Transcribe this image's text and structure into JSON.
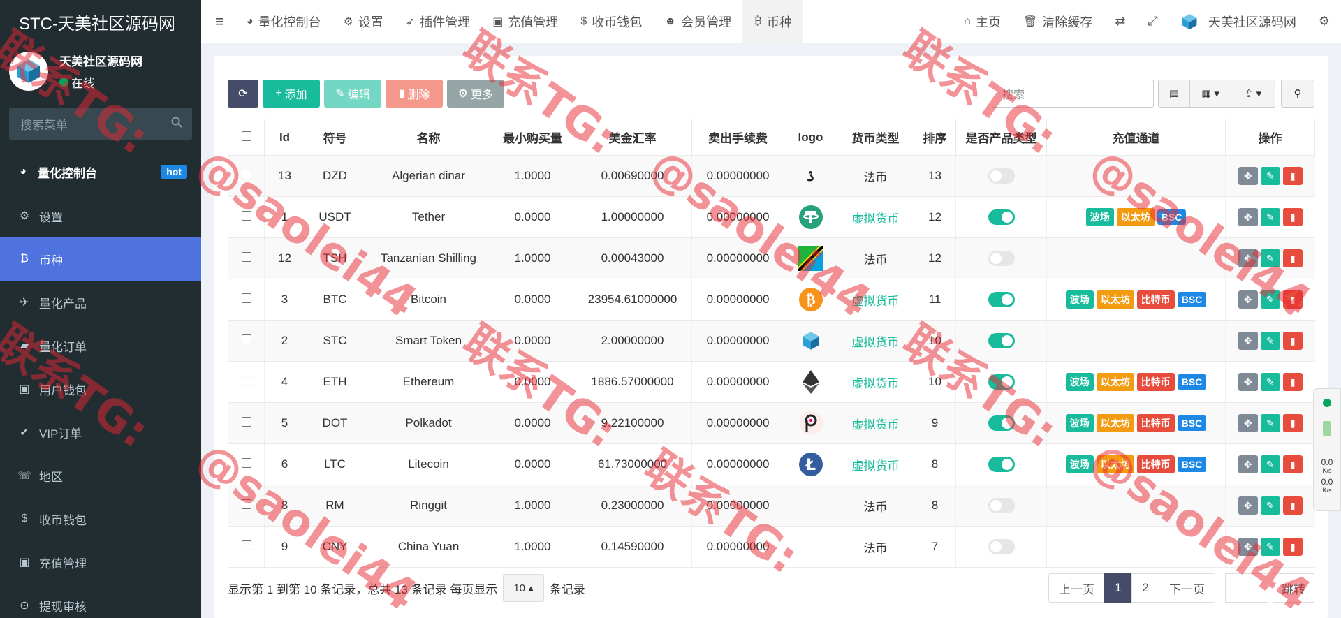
{
  "sidebar": {
    "brand": "STC-天美社区源码网",
    "user_name": "天美社区源码网",
    "user_status": "在线",
    "search_placeholder": "搜索菜单",
    "hot_badge": "hot",
    "items": [
      {
        "label": "量化控制台",
        "icon": "dashboard-icon",
        "glyph": "◕"
      },
      {
        "label": "设置",
        "icon": "gear-icon",
        "glyph": "⚙"
      },
      {
        "label": "币种",
        "icon": "bitcoin-icon",
        "glyph": "₿"
      },
      {
        "label": "量化产品",
        "icon": "plane-icon",
        "glyph": "✈"
      },
      {
        "label": "量化订单",
        "icon": "book-icon",
        "glyph": "▰"
      },
      {
        "label": "用户钱包",
        "icon": "money-icon",
        "glyph": "▣"
      },
      {
        "label": "VIP订单",
        "icon": "check-circle-icon",
        "glyph": "✔"
      },
      {
        "label": "地区",
        "icon": "phone-icon",
        "glyph": "☏"
      },
      {
        "label": "收币钱包",
        "icon": "dollar-icon",
        "glyph": "$"
      },
      {
        "label": "充值管理",
        "icon": "money-icon",
        "glyph": "▣"
      },
      {
        "label": "提现审核",
        "icon": "arrow-up-circle-icon",
        "glyph": "⊙"
      }
    ]
  },
  "topnav": {
    "tabs": [
      {
        "label": "量化控制台",
        "icon": "dashboard-icon",
        "glyph": "◕"
      },
      {
        "label": "设置",
        "icon": "gear-icon",
        "glyph": "⚙"
      },
      {
        "label": "插件管理",
        "icon": "rocket-icon",
        "glyph": "➶"
      },
      {
        "label": "充值管理",
        "icon": "money-icon",
        "glyph": "▣"
      },
      {
        "label": "收币钱包",
        "icon": "dollar-icon",
        "glyph": "$"
      },
      {
        "label": "会员管理",
        "icon": "user-icon",
        "glyph": "☻"
      },
      {
        "label": "币种",
        "icon": "bitcoin-icon",
        "glyph": "₿"
      }
    ],
    "home": "主页",
    "clear_cache": "清除缓存",
    "site_name": "天美社区源码网"
  },
  "toolbar": {
    "add": "添加",
    "edit": "编辑",
    "delete": "删除",
    "more": "更多",
    "search_placeholder": "搜索"
  },
  "table": {
    "headers": [
      "Id",
      "符号",
      "名称",
      "最小购买量",
      "美金汇率",
      "卖出手续费",
      "logo",
      "货币类型",
      "排序",
      "是否产品类型",
      "充值通道",
      "操作"
    ],
    "rows": [
      {
        "id": "13",
        "symbol": "DZD",
        "name": "Algerian dinar",
        "min": "1.0000",
        "rate": "0.00690000",
        "fee": "0.00000000",
        "logo": "dzd",
        "type": "法币",
        "virtual": false,
        "sort": "13",
        "product": false,
        "channels": []
      },
      {
        "id": "1",
        "symbol": "USDT",
        "name": "Tether",
        "min": "0.0000",
        "rate": "1.00000000",
        "fee": "0.00000000",
        "logo": "usdt",
        "type": "虚拟货币",
        "virtual": true,
        "sort": "12",
        "product": true,
        "channels": [
          "波场",
          "以太坊",
          "BSC"
        ]
      },
      {
        "id": "12",
        "symbol": "TSH",
        "name": "Tanzanian Shilling",
        "min": "1.0000",
        "rate": "0.00043000",
        "fee": "0.00000000",
        "logo": "tsh",
        "type": "法币",
        "virtual": false,
        "sort": "12",
        "product": false,
        "channels": []
      },
      {
        "id": "3",
        "symbol": "BTC",
        "name": "Bitcoin",
        "min": "0.0000",
        "rate": "23954.61000000",
        "fee": "0.00000000",
        "logo": "btc",
        "type": "虚拟货币",
        "virtual": true,
        "sort": "11",
        "product": true,
        "channels": [
          "波场",
          "以太坊",
          "比特币",
          "BSC"
        ]
      },
      {
        "id": "2",
        "symbol": "STC",
        "name": "Smart Token",
        "min": "0.0000",
        "rate": "2.00000000",
        "fee": "0.00000000",
        "logo": "stc",
        "type": "虚拟货币",
        "virtual": true,
        "sort": "10",
        "product": true,
        "channels": []
      },
      {
        "id": "4",
        "symbol": "ETH",
        "name": "Ethereum",
        "min": "0.0000",
        "rate": "1886.57000000",
        "fee": "0.00000000",
        "logo": "eth",
        "type": "虚拟货币",
        "virtual": true,
        "sort": "10",
        "product": true,
        "channels": [
          "波场",
          "以太坊",
          "比特币",
          "BSC"
        ]
      },
      {
        "id": "5",
        "symbol": "DOT",
        "name": "Polkadot",
        "min": "0.0000",
        "rate": "9.22100000",
        "fee": "0.00000000",
        "logo": "dot",
        "type": "虚拟货币",
        "virtual": true,
        "sort": "9",
        "product": true,
        "channels": [
          "波场",
          "以太坊",
          "比特币",
          "BSC"
        ]
      },
      {
        "id": "6",
        "symbol": "LTC",
        "name": "Litecoin",
        "min": "0.0000",
        "rate": "61.73000000",
        "fee": "0.00000000",
        "logo": "ltc",
        "type": "虚拟货币",
        "virtual": true,
        "sort": "8",
        "product": true,
        "channels": [
          "波场",
          "以太坊",
          "比特币",
          "BSC"
        ]
      },
      {
        "id": "8",
        "symbol": "RM",
        "name": "Ringgit",
        "min": "1.0000",
        "rate": "0.23000000",
        "fee": "0.00000000",
        "logo": "",
        "type": "法币",
        "virtual": false,
        "sort": "8",
        "product": false,
        "channels": []
      },
      {
        "id": "9",
        "symbol": "CNY",
        "name": "China Yuan",
        "min": "1.0000",
        "rate": "0.14590000",
        "fee": "0.00000000",
        "logo": "",
        "type": "法币",
        "virtual": false,
        "sort": "7",
        "product": false,
        "channels": []
      }
    ]
  },
  "footer": {
    "summary": "显示第 1 到第 10 条记录，总共 13 条记录 每页显示",
    "page_size": "10",
    "suffix": "条记录",
    "prev": "上一页",
    "pages": [
      "1",
      "2"
    ],
    "next": "下一页",
    "jump": "跳转"
  },
  "net_widget": {
    "up": "0.0",
    "down": "0.0",
    "unit": "K/s"
  },
  "watermark": {
    "line1": "联系TG:",
    "line2": "@saolei44"
  },
  "colors": {
    "accent": "#4e73df",
    "sidebar": "#222d32",
    "success": "#18bc9c",
    "danger": "#e74c3c",
    "warning": "#f39c12",
    "info": "#1e88e5"
  }
}
